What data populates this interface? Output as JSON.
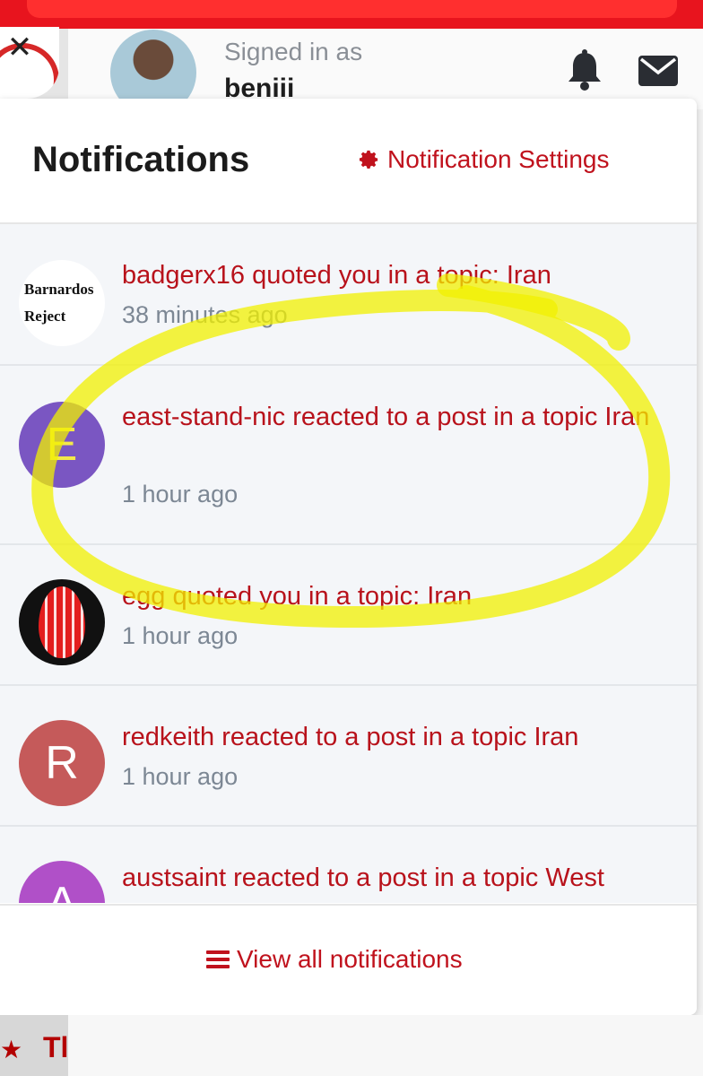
{
  "header": {
    "signed_in_label": "Signed in as",
    "username": "beniii",
    "close_glyph": "✕"
  },
  "panel": {
    "title": "Notifications",
    "settings_label": "Notification Settings",
    "view_all_label": "View all notifications"
  },
  "notifications": [
    {
      "text": "badgerx16 quoted you in a topic: Iran",
      "time": "38 minutes ago",
      "avatar_text": "Barnardos Reject"
    },
    {
      "text": "east-stand-nic reacted to a post in a topic Iran",
      "time": "1 hour ago",
      "avatar_letter": "E",
      "avatar_color": "#7a56c2",
      "letter_color": "#f3e84a"
    },
    {
      "text": "egg quoted you in a topic: Iran",
      "time": "1 hour ago"
    },
    {
      "text": "redkeith reacted to a post in a topic Iran",
      "time": "1 hour ago",
      "avatar_letter": "R",
      "avatar_color": "#c55a5a"
    },
    {
      "text": "austsaint reacted to a post in a topic West",
      "time": "",
      "avatar_letter": "A",
      "avatar_color": "#b050c8"
    }
  ],
  "bottom": {
    "partial_text": "Tl"
  },
  "colors": {
    "accent": "#c0121d",
    "highlight": "#f2f000"
  }
}
